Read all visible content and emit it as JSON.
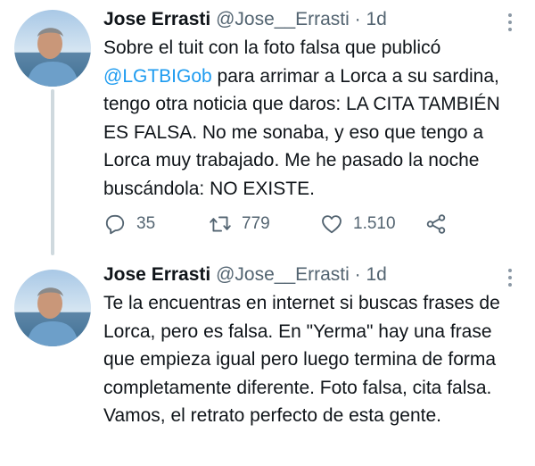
{
  "tweets": [
    {
      "author_name": "Jose Errasti",
      "handle": "@Jose__Errasti",
      "separator": "·",
      "time": "1d",
      "text_segments": [
        "Sobre el tuit con la foto falsa que publicó ",
        "@LGTBIGob",
        " para arrimar a Lorca a su sardina, tengo otra noticia que daros: LA CITA TAMBIÉN ES FALSA. No me sonaba, y eso que tengo a Lorca muy trabajado. Me he pasado la noche buscándola: NO EXISTE."
      ],
      "replies": "35",
      "retweets": "779",
      "likes": "1.510"
    },
    {
      "author_name": "Jose Errasti",
      "handle": "@Jose__Errasti",
      "separator": "·",
      "time": "1d",
      "text": "Te la encuentras en internet si buscas frases de Lorca, pero es falsa. En \"Yerma\" hay una frase que empieza igual pero luego termina de forma completamente diferente. Foto falsa, cita falsa. Vamos, el retrato perfecto de esta gente."
    }
  ],
  "colors": {
    "link": "#1d9bf0",
    "secondary_text": "#536471",
    "thread_line": "#cfd9de"
  },
  "icons": [
    "more-icon",
    "reply-icon",
    "retweet-icon",
    "like-icon",
    "share-icon"
  ]
}
